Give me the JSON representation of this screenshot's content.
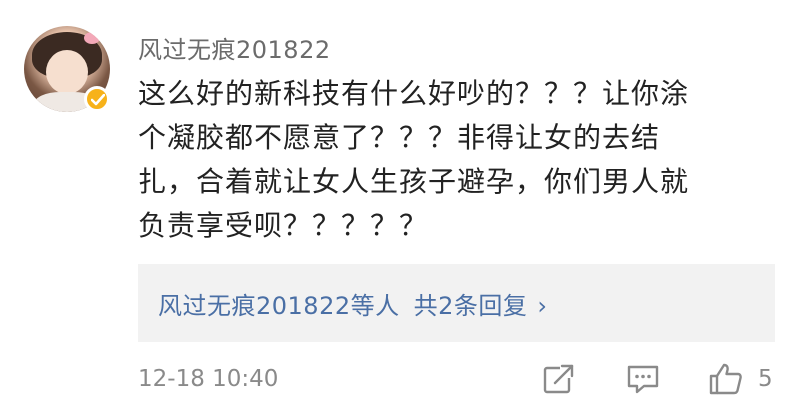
{
  "comment": {
    "username": "风过无痕201822",
    "lines": [
      "这么好的新科技有什么好吵的？？？让你涂",
      "个凝胶都不愿意了？？？非得让女的去结",
      "扎，合着就让女人生孩子避孕，你们男人就",
      "负责享受呗？？？？？"
    ],
    "timestamp": "12-18 10:40",
    "like_count": "5"
  },
  "replies": {
    "names": "风过无痕201822等人",
    "count_label": "共2条回复",
    "chevron": "›"
  },
  "icons": {
    "avatar": "user-avatar",
    "verified": "verified-badge-icon",
    "share": "share-icon",
    "reply": "reply-icon",
    "like": "thumbs-up-icon"
  },
  "colors": {
    "link": "#4a6fa5",
    "badge": "#f7b21a",
    "meta_text": "#8a8a8a",
    "reply_bg": "#f2f2f2"
  }
}
